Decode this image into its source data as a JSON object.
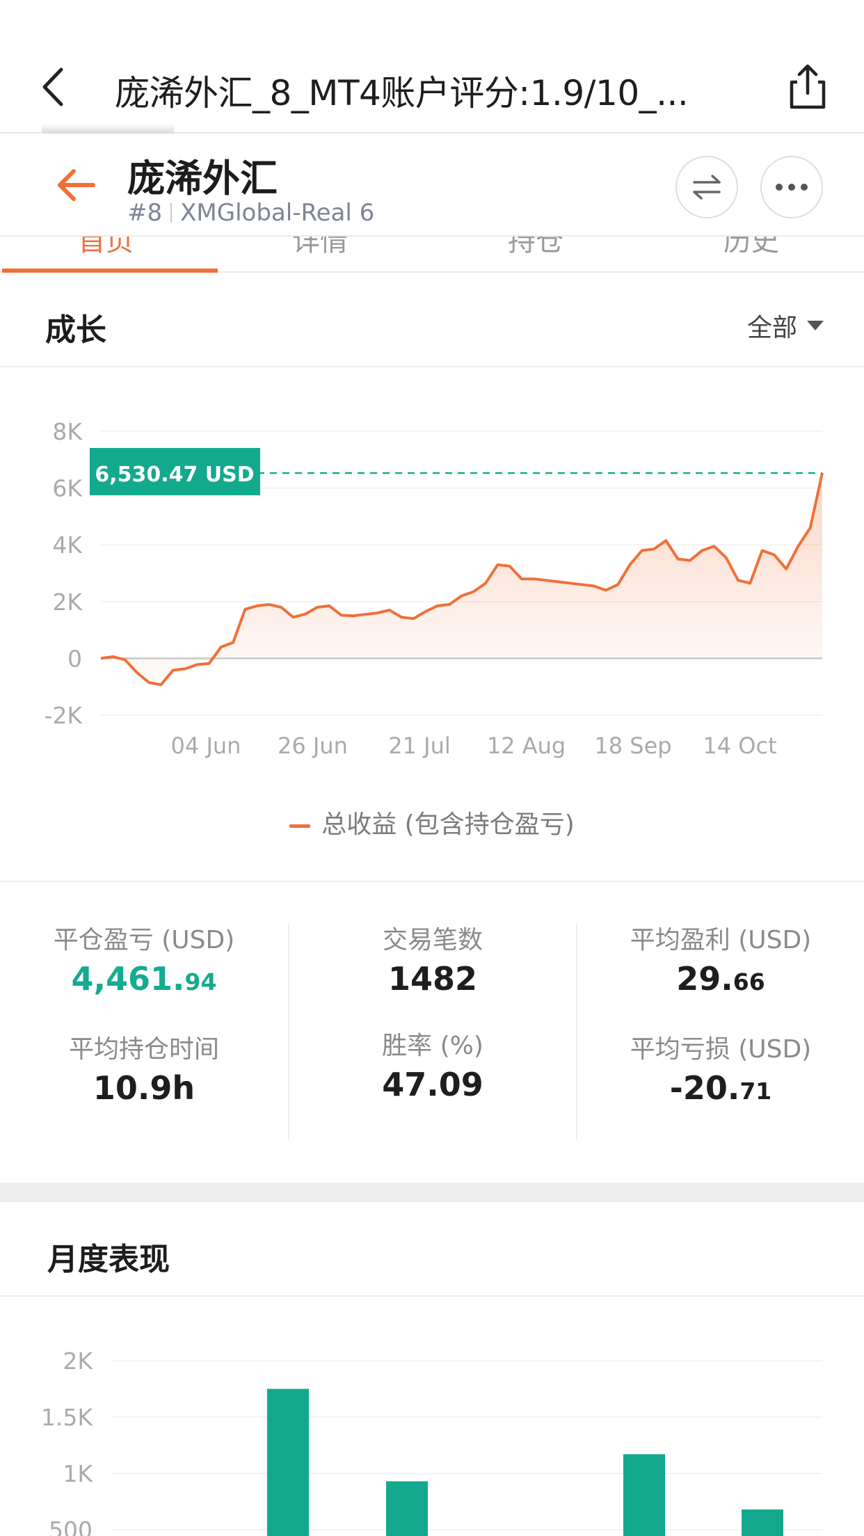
{
  "navbar": {
    "title": "庞浠外汇_8_MT4账户评分:1.9/10_..."
  },
  "account": {
    "name": "庞浠外汇",
    "rank": "#8",
    "server": "XMGlobal-Real 6"
  },
  "tabs": [
    "首页",
    "详情",
    "持仓",
    "历史"
  ],
  "growth": {
    "title": "成长",
    "range": "全部"
  },
  "chart_data": [
    {
      "type": "area",
      "ylim": [
        -2000,
        8000
      ],
      "yticks": [
        "8K",
        "6K",
        "4K",
        "2K",
        "0",
        "-2K"
      ],
      "xticks": [
        "04 Jun",
        "26 Jun",
        "21 Jul",
        "12 Aug",
        "18 Sep",
        "14 Oct"
      ],
      "current_label": "6,530.47 USD",
      "current_value": 6530.47,
      "series": [
        {
          "name": "总收益 (包含持仓盈亏)",
          "color": "#f07038",
          "values": [
            0,
            60,
            -50,
            -500,
            -850,
            -930,
            -420,
            -370,
            -220,
            -180,
            400,
            560,
            1730,
            1850,
            1900,
            1800,
            1450,
            1560,
            1800,
            1850,
            1520,
            1500,
            1550,
            1600,
            1700,
            1450,
            1400,
            1650,
            1850,
            1900,
            2200,
            2350,
            2650,
            3300,
            3250,
            2800,
            2800,
            2750,
            2700,
            2650,
            2600,
            2550,
            2400,
            2600,
            3300,
            3800,
            3850,
            4150,
            3500,
            3450,
            3800,
            3950,
            3550,
            2750,
            2650,
            3800,
            3650,
            3150,
            3950,
            4600,
            6530
          ]
        }
      ]
    },
    {
      "type": "bar",
      "ylim": [
        0,
        2000
      ],
      "yticks": [
        "2K",
        "1.5K",
        "1K",
        "500"
      ],
      "values": [
        1750,
        930,
        1170,
        680
      ],
      "color": "#13a98e"
    }
  ],
  "stats": {
    "closed_pnl": {
      "label": "平仓盈亏 (USD)",
      "int": "4,461.",
      "dec": "94"
    },
    "trades": {
      "label": "交易笔数",
      "value": "1482"
    },
    "avg_profit": {
      "label": "平均盈利 (USD)",
      "int": "29.",
      "dec": "66"
    },
    "avg_hold": {
      "label": "平均持仓时间",
      "value": "10.9h"
    },
    "win_rate": {
      "label": "胜率 (%)",
      "value": "47.09"
    },
    "avg_loss": {
      "label": "平均亏损 (USD)",
      "int": "-20.",
      "dec": "71"
    }
  },
  "monthly": {
    "title": "月度表现"
  }
}
